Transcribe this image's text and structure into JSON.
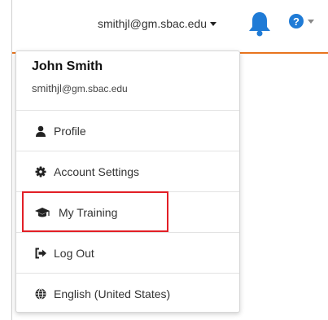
{
  "header": {
    "user_email": "smithjl@gm.sbac.edu",
    "help_symbol": "?",
    "accent_color": "#e8741e",
    "bell_color": "#1f7bd6"
  },
  "menu": {
    "name": "John Smith",
    "email_user": "smithjl",
    "email_domain": "@gm.sbac.edu",
    "items": [
      {
        "label": "Profile",
        "icon": "user-icon"
      },
      {
        "label": "Account Settings",
        "icon": "gear-icon"
      },
      {
        "label": "My Training",
        "icon": "graduation-cap-icon"
      },
      {
        "label": "Log Out",
        "icon": "sign-out-icon"
      },
      {
        "label": "English (United States)",
        "icon": "globe-icon"
      }
    ]
  },
  "annotation": {
    "highlight_color": "#e21f26"
  }
}
